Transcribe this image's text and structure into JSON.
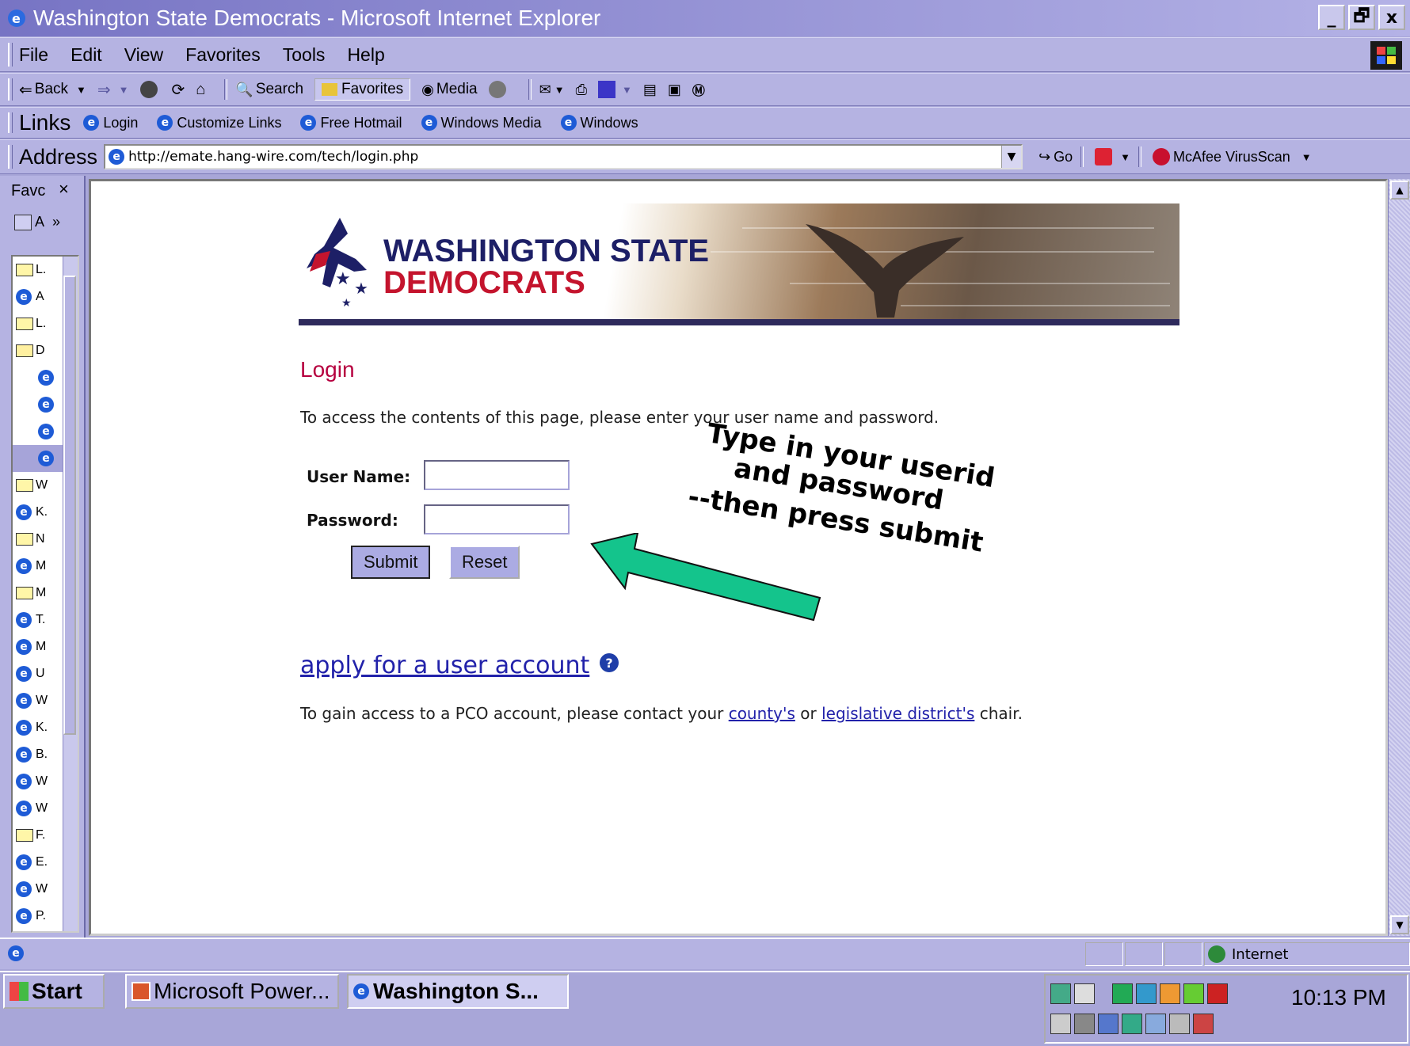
{
  "window": {
    "title": "Washington State Democrats - Microsoft Internet Explorer",
    "buttons": [
      "_",
      "🗗",
      "x"
    ]
  },
  "menu": [
    "File",
    "Edit",
    "View",
    "Favorites",
    "Tools",
    "Help"
  ],
  "toolbar": {
    "back": "Back",
    "search": "Search",
    "favorites": "Favorites",
    "media": "Media"
  },
  "links": {
    "title": "Links",
    "items": [
      "Login",
      "Customize Links",
      "Free Hotmail",
      "Windows Media",
      "Windows"
    ]
  },
  "address": {
    "label": "Address",
    "url": "http://emate.hang-wire.com/tech/login.php",
    "go": "Go",
    "mcafee": "McAfee VirusScan"
  },
  "favorites_pane": {
    "title": "Favc",
    "add_label": "A",
    "items": [
      {
        "type": "folder",
        "label": "L."
      },
      {
        "type": "page",
        "label": "A"
      },
      {
        "type": "folder",
        "label": "L."
      },
      {
        "type": "folder-open",
        "label": "D"
      },
      {
        "type": "page",
        "label": ""
      },
      {
        "type": "page",
        "label": ""
      },
      {
        "type": "page",
        "label": ""
      },
      {
        "type": "page-selected",
        "label": ""
      },
      {
        "type": "folder",
        "label": "W"
      },
      {
        "type": "page",
        "label": "K."
      },
      {
        "type": "folder",
        "label": "N"
      },
      {
        "type": "page",
        "label": "M"
      },
      {
        "type": "folder",
        "label": "M"
      },
      {
        "type": "page",
        "label": "T."
      },
      {
        "type": "page",
        "label": "M"
      },
      {
        "type": "page",
        "label": "U"
      },
      {
        "type": "page",
        "label": "W"
      },
      {
        "type": "page",
        "label": "K."
      },
      {
        "type": "page",
        "label": "B."
      },
      {
        "type": "page",
        "label": "W"
      },
      {
        "type": "page",
        "label": "W"
      },
      {
        "type": "folder",
        "label": "F."
      },
      {
        "type": "page",
        "label": "E."
      },
      {
        "type": "page",
        "label": "W"
      },
      {
        "type": "page",
        "label": "P."
      }
    ]
  },
  "page": {
    "banner": {
      "line1": "WASHINGTON STATE",
      "line2": "DEMOCRATS"
    },
    "heading": "Login",
    "instructions": "To access the contents of this page, please enter your user name and password.",
    "username_label": "User Name:",
    "password_label": "Password:",
    "username_value": "",
    "password_value": "",
    "submit": "Submit",
    "reset": "Reset",
    "callout": [
      "Type in your userid",
      "and password",
      "--then press submit"
    ],
    "apply_link": "apply for a user account",
    "pco_prefix": "To gain access to a PCO account, please contact your ",
    "pco_link1": "county's",
    "pco_mid": " or ",
    "pco_link2": "legislative district's",
    "pco_suffix": " chair."
  },
  "status": {
    "zone": "Internet"
  },
  "taskbar": {
    "start": "Start",
    "tasks": [
      "Microsoft Power...",
      "Washington S..."
    ],
    "clock": "10:13 PM"
  },
  "colors": {
    "accent": "#b6003f",
    "link": "#2222aa",
    "arrow": "#14c48c",
    "chrome": "#b5b3e2"
  }
}
